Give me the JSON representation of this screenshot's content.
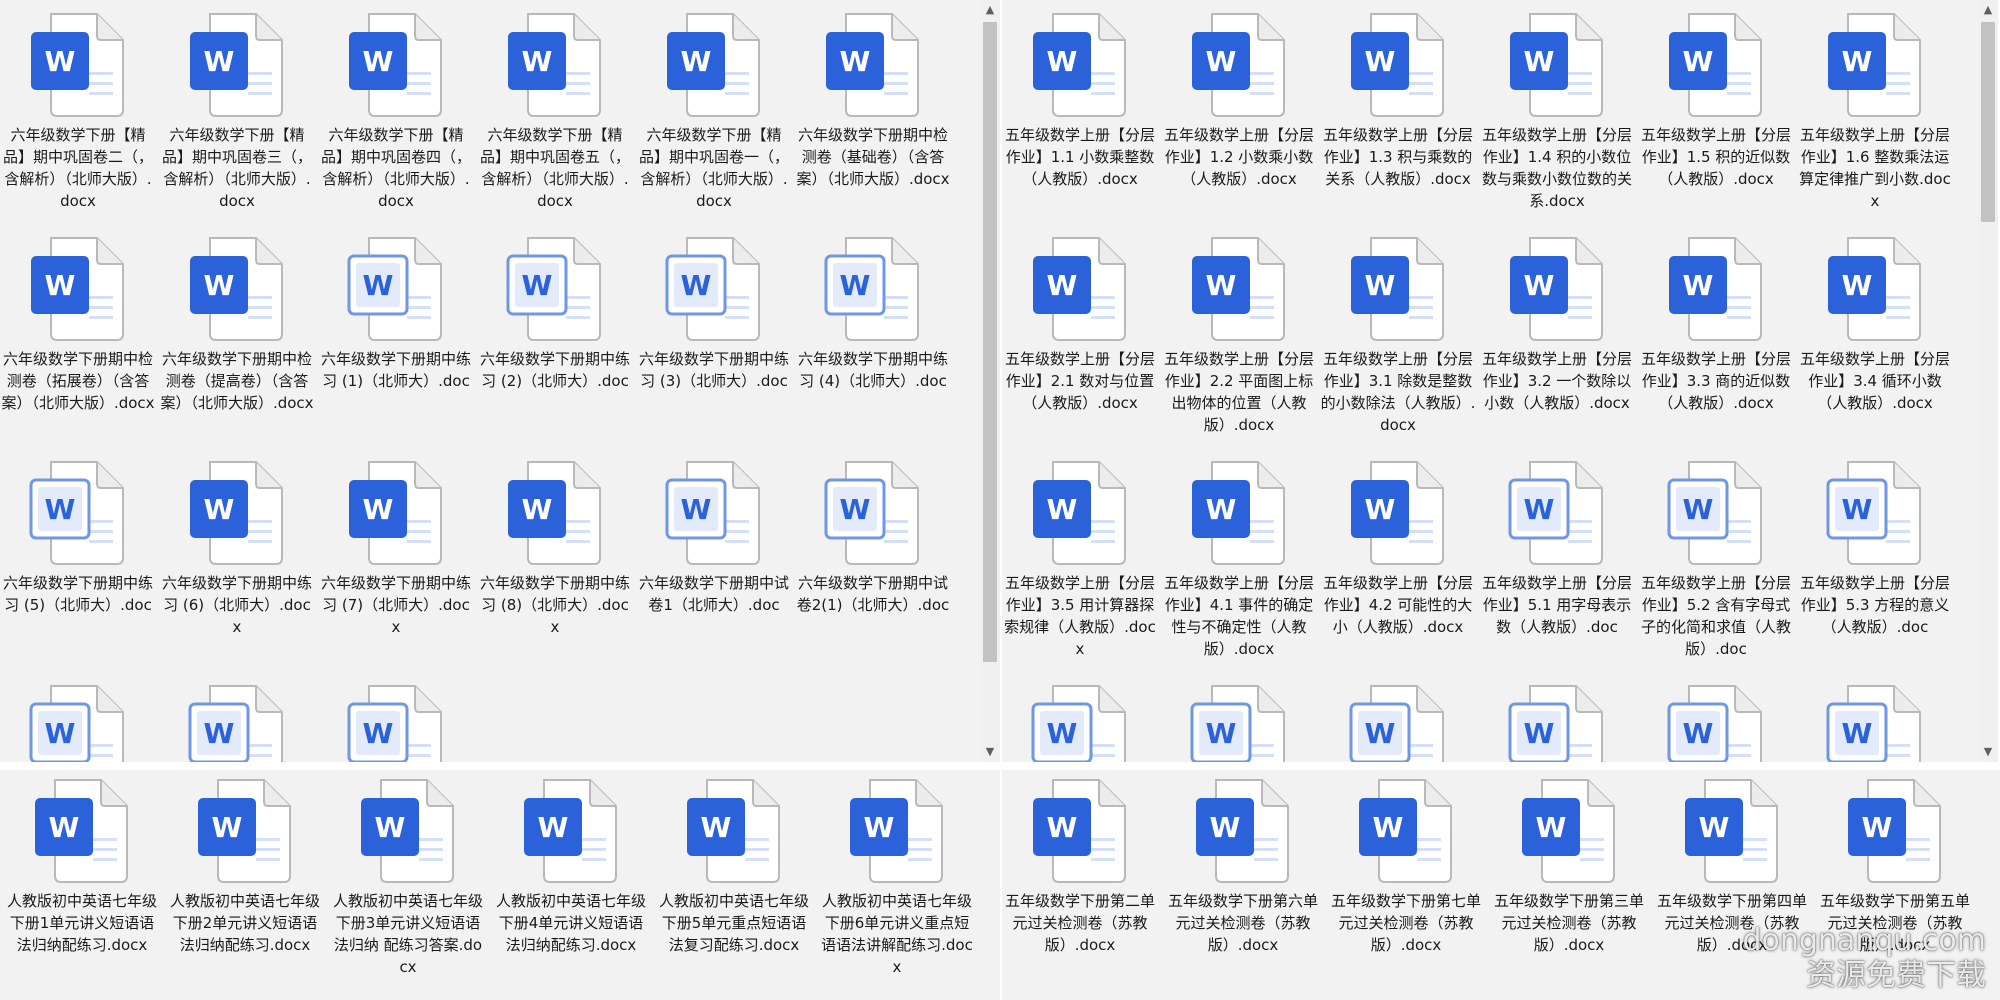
{
  "colors": {
    "word_blue": "#2b62d9",
    "word_blue_light": "#6f97e6",
    "pane_bg": "#f2f2f2",
    "text": "#1a1a1a"
  },
  "icon": {
    "letter": "W",
    "semantic": "word-document-icon"
  },
  "panes": {
    "top_left": {
      "columns": 6,
      "files": [
        {
          "name": "六年级数学下册【精品】期中巩固卷二（，含解析）（北师大版）.docx",
          "style": "solid"
        },
        {
          "name": "六年级数学下册【精品】期中巩固卷三（，含解析）（北师大版）.docx",
          "style": "solid"
        },
        {
          "name": "六年级数学下册【精品】期中巩固卷四（，含解析）（北师大版）.docx",
          "style": "solid"
        },
        {
          "name": "六年级数学下册【精品】期中巩固卷五（，含解析）（北师大版）.docx",
          "style": "solid"
        },
        {
          "name": "六年级数学下册【精品】期中巩固卷一（，含解析）（北师大版）.docx",
          "style": "solid"
        },
        {
          "name": "六年级数学下册期中检测卷（基础卷）（含答案）（北师大版）.docx",
          "style": "solid"
        },
        {
          "name": "六年级数学下册期中检测卷（拓展卷）（含答案）（北师大版）.docx",
          "style": "solid"
        },
        {
          "name": "六年级数学下册期中检测卷（提高卷）（含答案）（北师大版）.docx",
          "style": "solid"
        },
        {
          "name": "六年级数学下册期中练习 (1)（北师大）.doc",
          "style": "legacy"
        },
        {
          "name": "六年级数学下册期中练习 (2)（北师大）.doc",
          "style": "legacy"
        },
        {
          "name": "六年级数学下册期中练习 (3)（北师大）.doc",
          "style": "legacy"
        },
        {
          "name": "六年级数学下册期中练习 (4)（北师大）.doc",
          "style": "legacy"
        },
        {
          "name": "六年级数学下册期中练习 (5)（北师大）.doc",
          "style": "legacy"
        },
        {
          "name": "六年级数学下册期中练习 (6)（北师大）.docx",
          "style": "solid"
        },
        {
          "name": "六年级数学下册期中练习 (7)（北师大）.docx",
          "style": "solid"
        },
        {
          "name": "六年级数学下册期中练习 (8)（北师大）.docx",
          "style": "solid"
        },
        {
          "name": "六年级数学下册期中试卷1（北师大）.doc",
          "style": "legacy"
        },
        {
          "name": "六年级数学下册期中试卷2(1)（北师大）.doc",
          "style": "legacy"
        },
        {
          "name": "",
          "style": "legacy"
        },
        {
          "name": "",
          "style": "legacy"
        },
        {
          "name": "",
          "style": "legacy"
        }
      ]
    },
    "top_right": {
      "columns": 6,
      "files": [
        {
          "name": "五年级数学上册【分层作业】1.1 小数乘整数（人教版）.docx",
          "style": "solid"
        },
        {
          "name": "五年级数学上册【分层作业】1.2 小数乘小数（人教版）.docx",
          "style": "solid"
        },
        {
          "name": "五年级数学上册【分层作业】1.3 积与乘数的关系（人教版）.docx",
          "style": "solid"
        },
        {
          "name": "五年级数学上册【分层作业】1.4 积的小数位数与乘数小数位数的关系.docx",
          "style": "solid"
        },
        {
          "name": "五年级数学上册【分层作业】1.5 积的近似数（人教版）.docx",
          "style": "solid"
        },
        {
          "name": "五年级数学上册【分层作业】1.6 整数乘法运算定律推广到小数.docx",
          "style": "solid"
        },
        {
          "name": "五年级数学上册【分层作业】2.1 数对与位置（人教版）.docx",
          "style": "solid"
        },
        {
          "name": "五年级数学上册【分层作业】2.2 平面图上标出物体的位置（人教版）.docx",
          "style": "solid"
        },
        {
          "name": "五年级数学上册【分层作业】3.1 除数是整数的小数除法（人教版）.docx",
          "style": "solid"
        },
        {
          "name": "五年级数学上册【分层作业】3.2 一个数除以小数（人教版）.docx",
          "style": "solid"
        },
        {
          "name": "五年级数学上册【分层作业】3.3 商的近似数（人教版）.docx",
          "style": "solid"
        },
        {
          "name": "五年级数学上册【分层作业】3.4 循环小数（人教版）.docx",
          "style": "solid"
        },
        {
          "name": "五年级数学上册【分层作业】3.5 用计算器探索规律（人教版）.docx",
          "style": "solid"
        },
        {
          "name": "五年级数学上册【分层作业】4.1 事件的确定性与不确定性（人教版）.docx",
          "style": "solid"
        },
        {
          "name": "五年级数学上册【分层作业】4.2 可能性的大小（人教版）.docx",
          "style": "solid"
        },
        {
          "name": "五年级数学上册【分层作业】5.1 用字母表示数（人教版）.doc",
          "style": "legacy"
        },
        {
          "name": "五年级数学上册【分层作业】5.2 含有字母式子的化简和求值（人教版）.doc",
          "style": "legacy"
        },
        {
          "name": "五年级数学上册【分层作业】5.3 方程的意义（人教版）.doc",
          "style": "legacy"
        },
        {
          "name": "",
          "style": "legacy"
        },
        {
          "name": "",
          "style": "legacy"
        },
        {
          "name": "",
          "style": "legacy"
        },
        {
          "name": "",
          "style": "legacy"
        },
        {
          "name": "",
          "style": "legacy"
        },
        {
          "name": "",
          "style": "legacy"
        }
      ]
    },
    "bottom_left": {
      "columns": 6,
      "files": [
        {
          "name": "人教版初中英语七年级下册1单元讲义短语语法归纳配练习.docx",
          "style": "solid"
        },
        {
          "name": "人教版初中英语七年级下册2单元讲义短语语法归纳配练习.docx",
          "style": "solid"
        },
        {
          "name": "人教版初中英语七年级下册3单元讲义短语语法归纳 配练习答案.docx",
          "style": "solid"
        },
        {
          "name": "人教版初中英语七年级下册4单元讲义短语语法归纳配练习.docx",
          "style": "solid"
        },
        {
          "name": "人教版初中英语七年级下册5单元重点短语语法复习配练习.docx",
          "style": "solid"
        },
        {
          "name": "人教版初中英语七年级下册6单元讲义重点短语语法讲解配练习.docx",
          "style": "solid"
        }
      ]
    },
    "bottom_right": {
      "columns": 6,
      "files": [
        {
          "name": "五年级数学下册第二单元过关检测卷（苏教版）.docx",
          "style": "solid"
        },
        {
          "name": "五年级数学下册第六单元过关检测卷（苏教版）.docx",
          "style": "solid"
        },
        {
          "name": "五年级数学下册第七单元过关检测卷（苏教版）.docx",
          "style": "solid"
        },
        {
          "name": "五年级数学下册第三单元过关检测卷（苏教版）.docx",
          "style": "solid"
        },
        {
          "name": "五年级数学下册第四单元过关检测卷（苏教版）.docx",
          "style": "solid"
        },
        {
          "name": "五年级数学下册第五单元过关检测卷（苏教版）.docx",
          "style": "solid"
        }
      ]
    }
  },
  "scrollbars": {
    "up_glyph": "▲",
    "down_glyph": "▼"
  },
  "watermark": {
    "line1": "dongnanqu.com",
    "line2": "资源免费下载"
  }
}
